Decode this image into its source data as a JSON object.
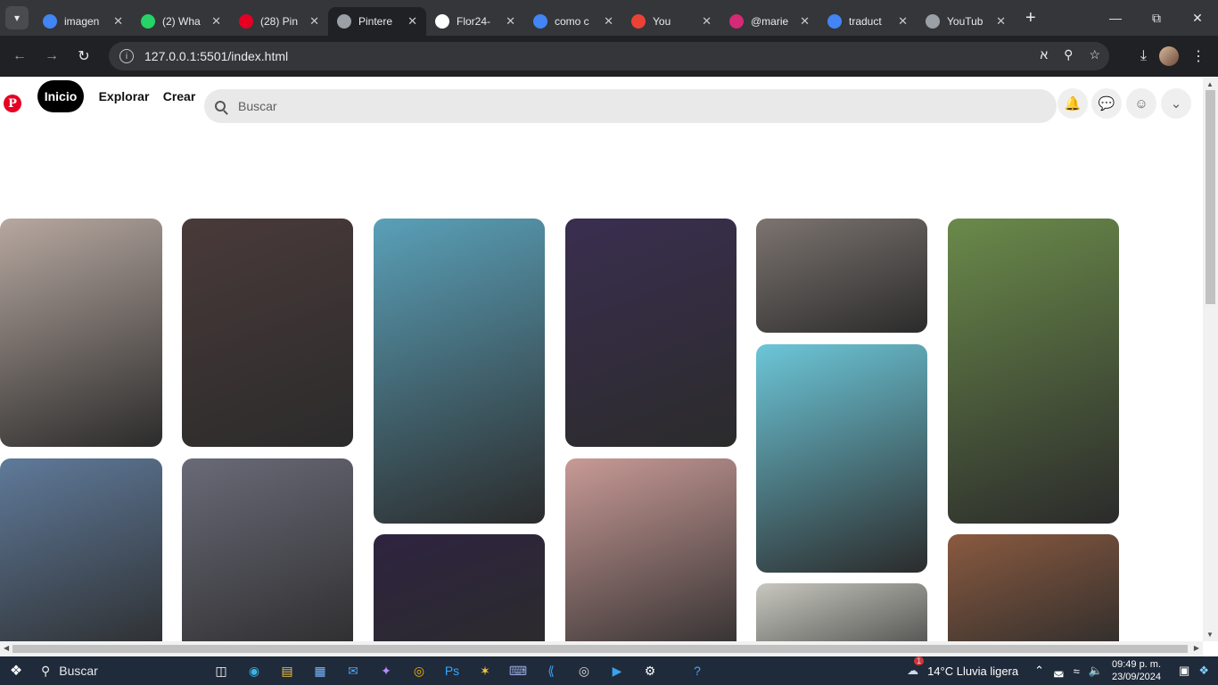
{
  "browser": {
    "tabs": [
      {
        "title": "imagen",
        "icon": "google-icon",
        "color": "#4285f4"
      },
      {
        "title": "(2) Wha",
        "icon": "whatsapp-icon",
        "color": "#25d366"
      },
      {
        "title": "(28) Pin",
        "icon": "pinterest-icon",
        "color": "#e60023"
      },
      {
        "title": "Pintere",
        "icon": "globe-icon",
        "color": "#9aa0a6",
        "active": true
      },
      {
        "title": "Flor24-",
        "icon": "github-icon",
        "color": "#ffffff"
      },
      {
        "title": "como c",
        "icon": "google-icon",
        "color": "#4285f4"
      },
      {
        "title": "You",
        "icon": "gmail-icon",
        "color": "#ea4335"
      },
      {
        "title": "@marie",
        "icon": "instagram-icon",
        "color": "#d62976"
      },
      {
        "title": "traduct",
        "icon": "google-icon",
        "color": "#4285f4"
      },
      {
        "title": "YouTub",
        "icon": "globe-icon",
        "color": "#9aa0a6"
      }
    ],
    "url": "127.0.0.1:5501/index.html"
  },
  "header": {
    "logo": "P",
    "nav": {
      "home": "Inicio",
      "explore": "Explorar",
      "create": "Crear"
    },
    "search_placeholder": "Buscar"
  },
  "pins": [
    {
      "color": "#b7a8a0"
    },
    {
      "color": "#4a3a3a"
    },
    {
      "color": "#5aa0b8"
    },
    {
      "color": "#3a2e50"
    },
    {
      "color": "#7c7470"
    },
    {
      "color": "#6a8a4a"
    },
    {
      "color": "#5f7a9a"
    },
    {
      "color": "#6a6a78"
    },
    {
      "color": "#2e2440"
    },
    {
      "color": "#c89a96"
    },
    {
      "color": "#6cc6d8"
    },
    {
      "color": "#8a5a40"
    },
    {
      "color": "#c8c8c0"
    }
  ],
  "taskbar": {
    "search": "Buscar",
    "weather": "14°C  Lluvia ligera",
    "time": "09:49 p. m.",
    "date": "23/09/2024",
    "notification_count": "1"
  }
}
